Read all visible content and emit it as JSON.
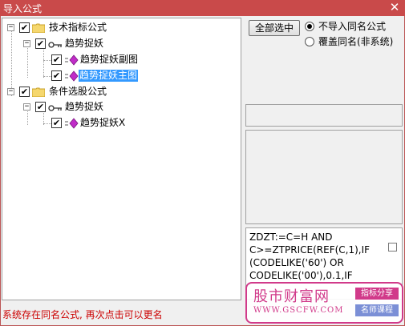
{
  "window": {
    "title": "导入公式",
    "close_glyph": "✕"
  },
  "tree": {
    "nodes": [
      {
        "label": "技术指标公式",
        "expander": "−",
        "checked": "✔"
      },
      {
        "label": "趋势捉妖",
        "expander": "−",
        "checked": "✔"
      },
      {
        "label": "趋势捉妖副图",
        "checked": "✔"
      },
      {
        "label": "趋势捉妖主图",
        "checked": "✔",
        "selected": true
      },
      {
        "label": "条件选股公式",
        "expander": "−",
        "checked": "✔"
      },
      {
        "label": "趋势捉妖",
        "expander": "−",
        "checked": "✔"
      },
      {
        "label": "趋势捉妖X",
        "checked": "✔"
      }
    ]
  },
  "options": {
    "select_all_label": "全部选中",
    "radio_no_import": "不导入同名公式",
    "radio_overwrite": "覆盖同名(非系统)",
    "selected_radio": "不导入同名公式"
  },
  "code": {
    "lines": [
      "ZDZT:=C=H AND",
      "C>=ZTPRICE(REF(C,1),IF",
      "(CODELIKE('60') OR",
      "CODELIKE('00'),0.1,IF"
    ]
  },
  "status": {
    "message": "系统存在同名公式, 再次点击可以更名"
  },
  "watermark": {
    "brand": "股市财富网",
    "url": "WWW.GSCFW.COM",
    "tag_1": "指标分享",
    "tag_2": "名师课程"
  },
  "colors": {
    "title_bar": "#c94a4a",
    "selection": "#3399ff",
    "status_text": "#cc0000",
    "watermark": "#d13a8a"
  }
}
